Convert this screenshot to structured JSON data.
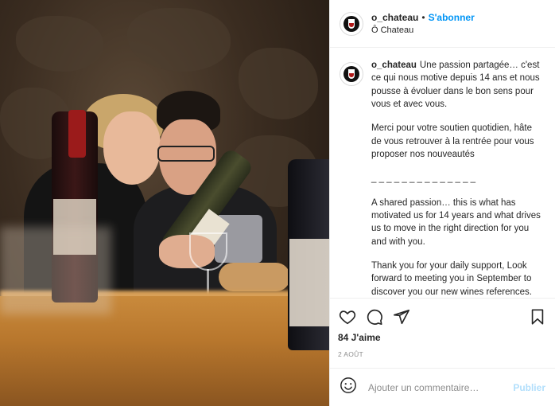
{
  "header": {
    "username": "o_chateau",
    "separator": "•",
    "follow_label": "S'abonner",
    "location": "Ô Chateau"
  },
  "caption": {
    "username": "o_chateau",
    "p1": "Une passion partagée… c'est ce qui nous motive depuis 14 ans et nous pousse à évoluer dans le bon sens pour vous et avec vous.",
    "p2": "Merci pour votre soutien quotidien, hâte de vous retrouver à la rentrée pour vous proposer nos nouveautés",
    "divider": "_ _ _ _ _ _ _ _ _ _ _ _ _ _",
    "p3": "A shared passion… this is what has motivated us for 14 years and what drives us to move in the right direction for you and with you.",
    "p4": "Thank you for your daily support, Look forward to meeting you in September to discover you our new wines references."
  },
  "actions": {
    "icons": [
      "heart-icon",
      "comment-icon",
      "share-icon",
      "bookmark-icon"
    ],
    "likes": "84 J'aime",
    "date": "2 AOÛT"
  },
  "comment": {
    "placeholder": "Ajouter un commentaire…",
    "publish_label": "Publier",
    "emoji_icon": "smiley-icon"
  },
  "colors": {
    "accent": "#0095f6",
    "publish_disabled": "#b2dffc",
    "muted": "#8e8e8e"
  }
}
